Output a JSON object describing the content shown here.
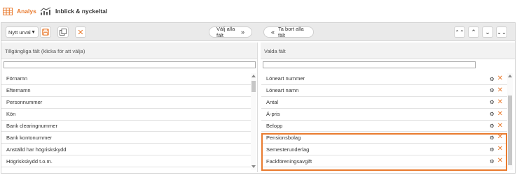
{
  "tabs": [
    {
      "label": "Analys",
      "icon": "table-icon",
      "active": true
    },
    {
      "label": "Inblick & nyckeltal",
      "icon": "chart-icon",
      "active": false
    }
  ],
  "toolbar": {
    "select_value": "Nytt urval",
    "select_all_label": "Välj alla fält",
    "remove_all_label": "Ta bort alla fält"
  },
  "left_panel": {
    "title": "Tillgängliga fält (klicka för att välja)",
    "filter_value": "",
    "items": [
      "Förnamn",
      "Efternamn",
      "Personnummer",
      "Kön",
      "Bank clearingnummer",
      "Bank kontonummer",
      "Anställd har högriskskydd",
      "Högriskskydd t.o.m."
    ]
  },
  "right_panel": {
    "title": "Valda fält",
    "filter_value": "",
    "items": [
      "Löneart nummer",
      "Löneart namn",
      "Antal",
      "Á-pris",
      "Belopp",
      "Pensionsbolag",
      "Semesterunderlag",
      "Fackföreningsavgift"
    ]
  },
  "colors": {
    "accent": "#e97a2d",
    "toolbar_bg": "#eaeaea",
    "header_bg": "#f2f2f2"
  }
}
